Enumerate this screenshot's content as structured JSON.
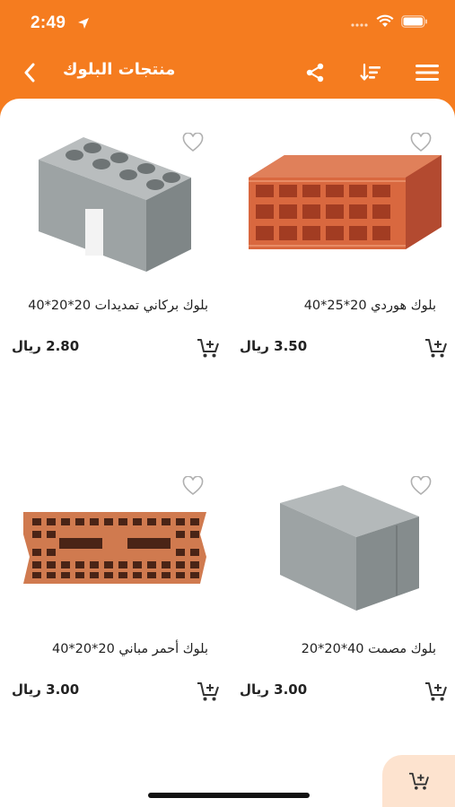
{
  "status_bar": {
    "time": "2:49"
  },
  "header": {
    "title": "منتجات البلوك"
  },
  "products": [
    {
      "title": "بلوك هوردي 20*25*40",
      "price": "3.50",
      "currency": "ريال"
    },
    {
      "title": "بلوك بركاني تمديدات 20*20*40",
      "price": "2.80",
      "currency": "ريال"
    },
    {
      "title": "بلوك مصمت 40*20*20",
      "price": "3.00",
      "currency": "ريال"
    },
    {
      "title": "بلوك أحمر مباني 20*20*40",
      "price": "3.00",
      "currency": "ريال"
    }
  ],
  "colors": {
    "brand": "#f57c1f",
    "fab_bg": "#fde3cf",
    "brick": "#d9683f",
    "concrete": "#9da3a4"
  },
  "icons": [
    "location-arrow-icon",
    "wifi-icon",
    "battery-icon",
    "chevron-left-icon",
    "share-icon",
    "sort-icon",
    "menu-icon",
    "heart-icon",
    "add-to-cart-icon"
  ]
}
